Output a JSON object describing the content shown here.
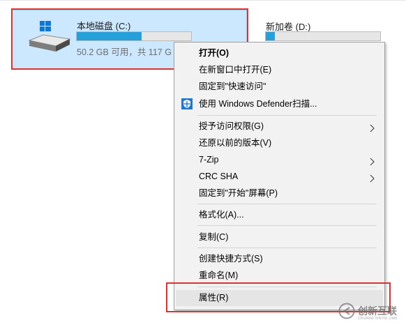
{
  "drives": [
    {
      "name": "本地磁盘 (C:)",
      "info": "50.2 GB 可用，共 117 G",
      "fill_fraction": 0.57,
      "selected": true
    },
    {
      "name": "新加卷 (D:)",
      "info": "",
      "fill_fraction": 0.08,
      "selected": false
    }
  ],
  "context_menu": {
    "items": [
      {
        "label": "打开(O)"
      },
      {
        "label": "在新窗口中打开(E)"
      },
      {
        "label": "固定到\"快速访问\""
      },
      {
        "label": "使用 Windows Defender扫描..."
      },
      {
        "label": "授予访问权限(G)"
      },
      {
        "label": "还原以前的版本(V)"
      },
      {
        "label": "7-Zip"
      },
      {
        "label": "CRC SHA"
      },
      {
        "label": "固定到\"开始\"屏幕(P)"
      },
      {
        "label": "格式化(A)..."
      },
      {
        "label": "复制(C)"
      },
      {
        "label": "创建快捷方式(S)"
      },
      {
        "label": "重命名(M)"
      },
      {
        "label": "属性(R)"
      }
    ]
  },
  "watermark": {
    "text": "创新互联",
    "subtext": "CHUANG XIN HU LIAN"
  },
  "colors": {
    "selection_bg": "#cce8ff",
    "selection_border": "#99d1ff",
    "usage_bar": "#26a0da",
    "highlight_red": "#e0302e",
    "menu_bg": "#f2f2f2",
    "hover_bg": "#e5e5e5"
  }
}
